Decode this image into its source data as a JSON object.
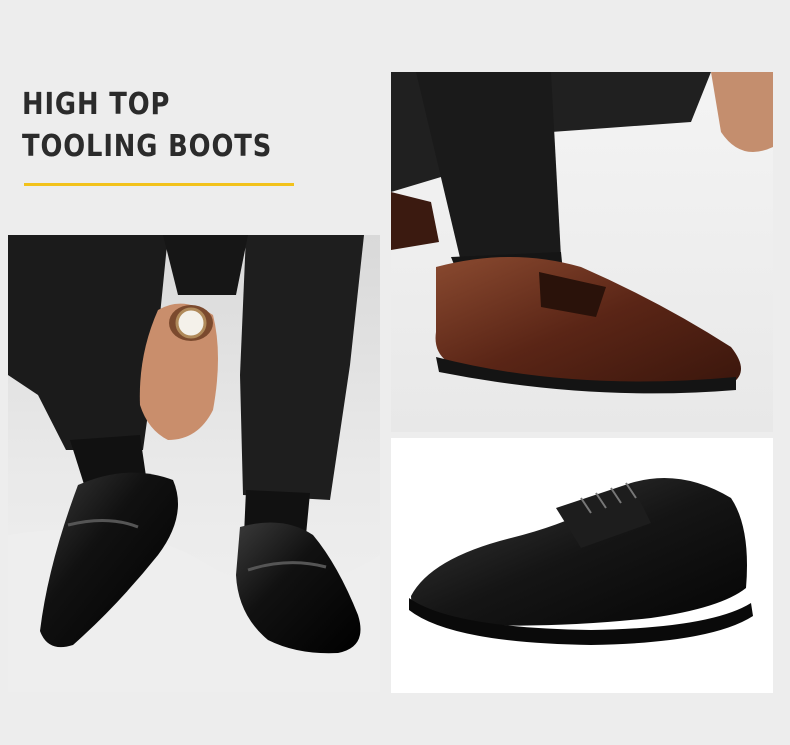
{
  "headline": {
    "line1": "HIGH TOP",
    "line2": "TOOLING BOOTS"
  },
  "colors": {
    "background": "#ededed",
    "accent": "#f2c21b",
    "headline_text": "#2b2b2b",
    "trouser": "#1c1c1c",
    "shoe_black": "#141414",
    "shoe_brown": "#5a2a1a"
  },
  "photos": [
    {
      "name": "man-adjusting-black-loafers-photo"
    },
    {
      "name": "brown-loafer-on-foot-photo"
    },
    {
      "name": "black-derby-shoe-photo"
    }
  ]
}
